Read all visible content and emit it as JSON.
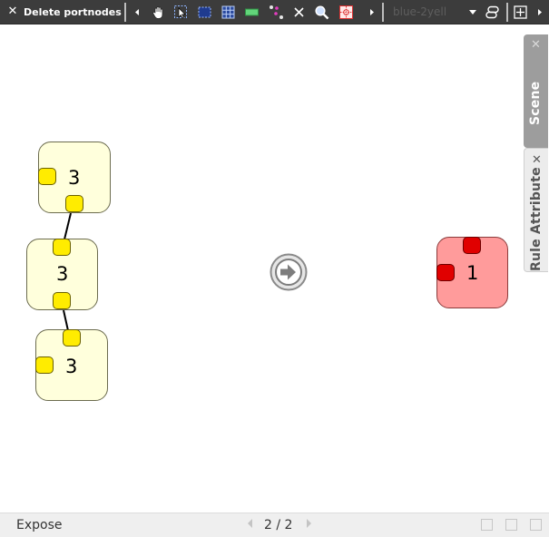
{
  "toolbar": {
    "close_icon": "close-icon",
    "title": "Delete portnodes c",
    "tools": [
      {
        "name": "scroll-left-icon",
        "glyph": "left-triangle"
      },
      {
        "name": "hand-icon"
      },
      {
        "name": "select-pointer-icon"
      },
      {
        "name": "select-box-icon"
      },
      {
        "name": "grid-icon"
      },
      {
        "name": "green-block-icon"
      },
      {
        "name": "connect-icon"
      },
      {
        "name": "delete-x-icon"
      },
      {
        "name": "zoom-icon"
      },
      {
        "name": "layout-icon"
      },
      {
        "name": "scroll-right-icon"
      }
    ],
    "dropdown_value": "blue-2yell",
    "right_icons": [
      "link-icon",
      "fit-view-icon",
      "more-icon"
    ]
  },
  "canvas": {
    "left_nodes": [
      {
        "count": "3"
      },
      {
        "count": "3"
      },
      {
        "count": "3"
      }
    ],
    "right_node": {
      "count": "1"
    },
    "arrow_button": "arrow-right-icon",
    "colors": {
      "node_yellow": "#ffffdc",
      "port_yellow": "#ffec00",
      "node_red": "#ff9b9b",
      "port_red": "#e00000"
    }
  },
  "side_panels": {
    "scene": {
      "label": "Scene"
    },
    "attribute": {
      "label": "Rule Attribute"
    }
  },
  "statusbar": {
    "mode": "Expose",
    "page": "2 / 2"
  }
}
